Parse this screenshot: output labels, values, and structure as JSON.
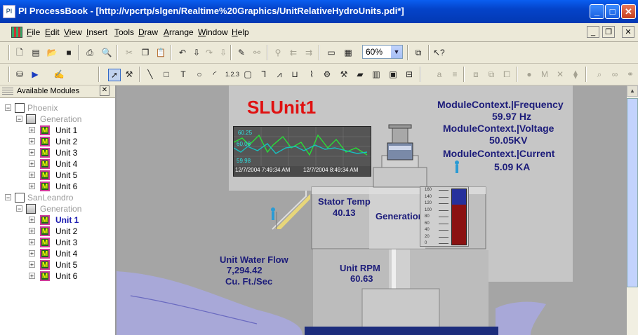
{
  "window": {
    "title": "PI ProcessBook - [http://vpcrtp/slgen/Realtime%20Graphics/UnitRelativeHydroUnits.pdi*]",
    "minimize": "_",
    "maximize": "□",
    "close": "✕"
  },
  "menu": {
    "items": [
      "File",
      "Edit",
      "View",
      "Insert",
      "Tools",
      "Draw",
      "Arrange",
      "Window",
      "Help"
    ],
    "mdi_minimize": "_",
    "mdi_restore": "❐",
    "mdi_close": "✕"
  },
  "toolbar": {
    "zoom_value": "60%"
  },
  "panel": {
    "title": "Available Modules",
    "close": "✕",
    "tree": {
      "server1": "Phoenix",
      "folder1": "Generation",
      "units1": [
        "Unit 1",
        "Unit 2",
        "Unit 3",
        "Unit 4",
        "Unit 5",
        "Unit 6"
      ],
      "server2": "SanLeandro",
      "folder2": "Generation",
      "units2": [
        "Unit 1",
        "Unit 2",
        "Unit 3",
        "Unit 4",
        "Unit 5",
        "Unit 6"
      ],
      "unit_icon_letter": "M"
    }
  },
  "display": {
    "unit_title": "SLUnit1",
    "frequency_label": "ModuleContext.|Frequency",
    "frequency_value": "59.97 Hz",
    "voltage_label": "ModuleContext.|Voltage",
    "voltage_value": "50.05KV",
    "current_label": "ModuleContext.|Current",
    "current_value": "5.09 KA",
    "stator_label": "Stator Temp",
    "stator_value": "40.13",
    "generation_label": "Generation",
    "water_flow_label": "Unit Water Flow",
    "water_flow_value": "7,294.42",
    "water_flow_unit": "Cu. Ft./Sec",
    "rpm_label": "Unit RPM",
    "rpm_value": "60.63",
    "trend": {
      "top_value": "60.25",
      "mid_value": "60.08",
      "low_value": "59.98",
      "start_time": "12/7/2004 7:49:34 AM",
      "end_time": "12/7/2004 8:49:34 AM"
    },
    "gauge": {
      "ticks": [
        "160",
        "140",
        "120",
        "100",
        "80",
        "60",
        "40",
        "20",
        "0"
      ],
      "fill_fraction": 0.72
    }
  },
  "colors": {
    "title_red": "#e01010",
    "label_blue": "#1c1c7a",
    "water": "#a8a8d8"
  }
}
